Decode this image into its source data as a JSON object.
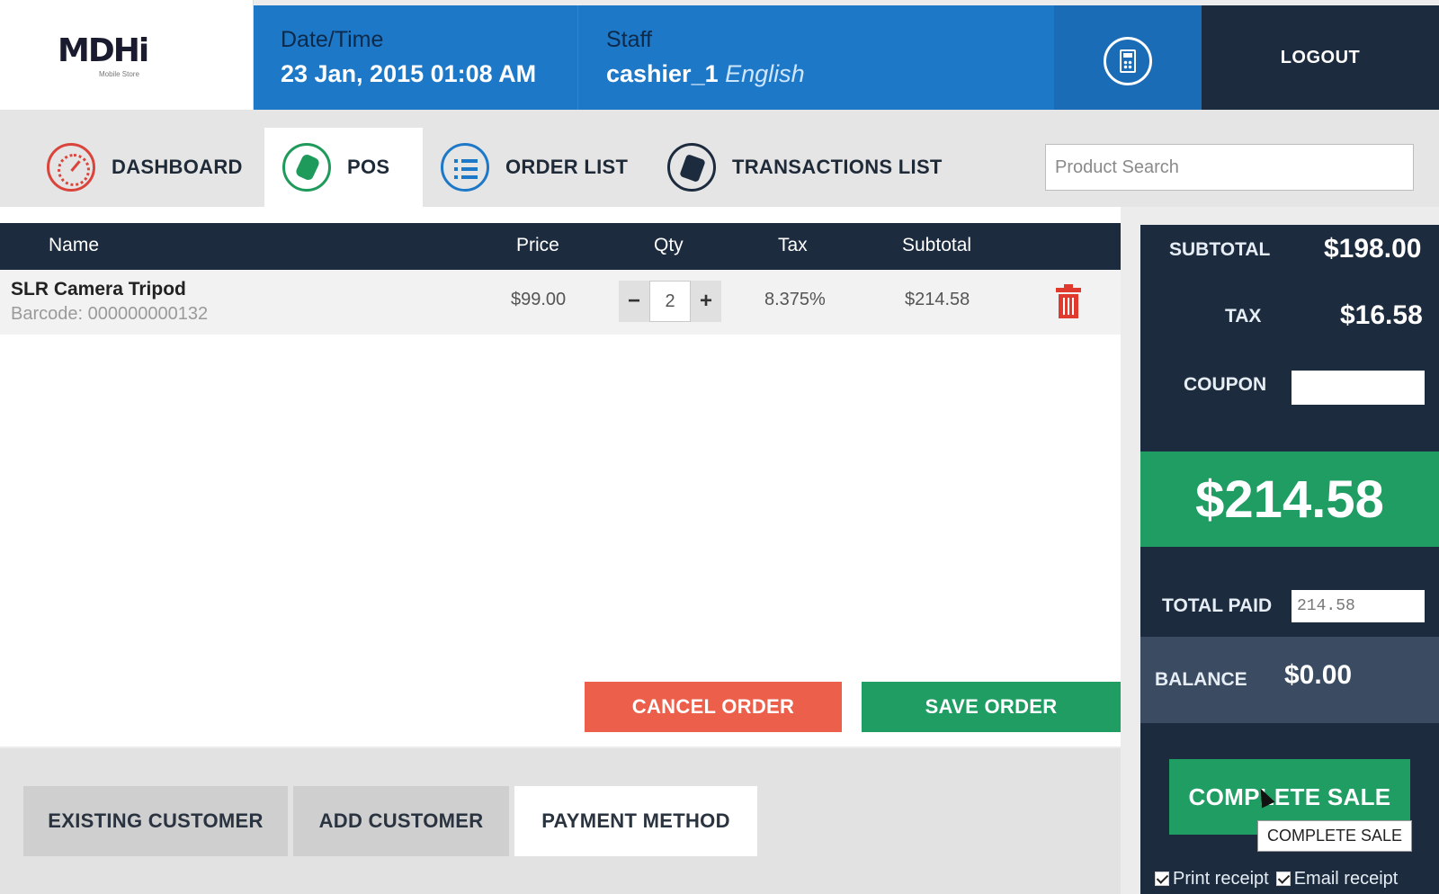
{
  "header": {
    "logo_text": "MDHi",
    "logo_subtext": "Mobile Store",
    "datetime_label": "Date/Time",
    "datetime_value": "23 Jan, 2015 01:08 AM",
    "staff_label": "Staff",
    "staff_name": "cashier_1",
    "staff_language": "English",
    "logout_label": "LOGOUT"
  },
  "nav": {
    "tabs": [
      {
        "label": "DASHBOARD",
        "icon": "speedometer-icon"
      },
      {
        "label": "POS",
        "icon": "money-bag-icon"
      },
      {
        "label": "ORDER LIST",
        "icon": "list-icon"
      },
      {
        "label": "TRANSACTIONS LIST",
        "icon": "receipt-icon"
      }
    ],
    "active_tab": "POS",
    "search_placeholder": "Product Search"
  },
  "cart": {
    "columns": [
      "Name",
      "Price",
      "Qty",
      "Tax",
      "Subtotal"
    ],
    "items": [
      {
        "name": "SLR Camera Tripod",
        "barcode": "Barcode: 000000000132",
        "price": "$99.00",
        "qty": "2",
        "tax": "8.375%",
        "subtotal": "$214.58"
      }
    ],
    "qty_minus": "−",
    "qty_plus": "+",
    "cancel_label": "CANCEL ORDER",
    "save_label": "SAVE ORDER"
  },
  "bottom_tabs": {
    "tabs": [
      "EXISTING CUSTOMER",
      "ADD CUSTOMER",
      "PAYMENT METHOD"
    ],
    "active_tab": "PAYMENT METHOD"
  },
  "summary": {
    "subtotal_label": "SUBTOTAL",
    "subtotal_value": "$198.00",
    "tax_label": "TAX",
    "tax_value": "$16.58",
    "coupon_label": "COUPON",
    "coupon_value": "",
    "total_value": "$214.58",
    "total_paid_label": "TOTAL PAID",
    "total_paid_value": "214.58",
    "balance_label": "BALANCE",
    "balance_value": "$0.00",
    "complete_label": "COMPLETE SALE",
    "tooltip": "COMPLETE SALE",
    "print_receipt_label": "Print receipt",
    "email_receipt_label": "Email receipt",
    "print_receipt_checked": true,
    "email_receipt_checked": true
  },
  "colors": {
    "header_blue": "#1e78c8",
    "dark_navy": "#1c2b3d",
    "green": "#1f9d63",
    "cancel_red": "#ec5f4a"
  }
}
